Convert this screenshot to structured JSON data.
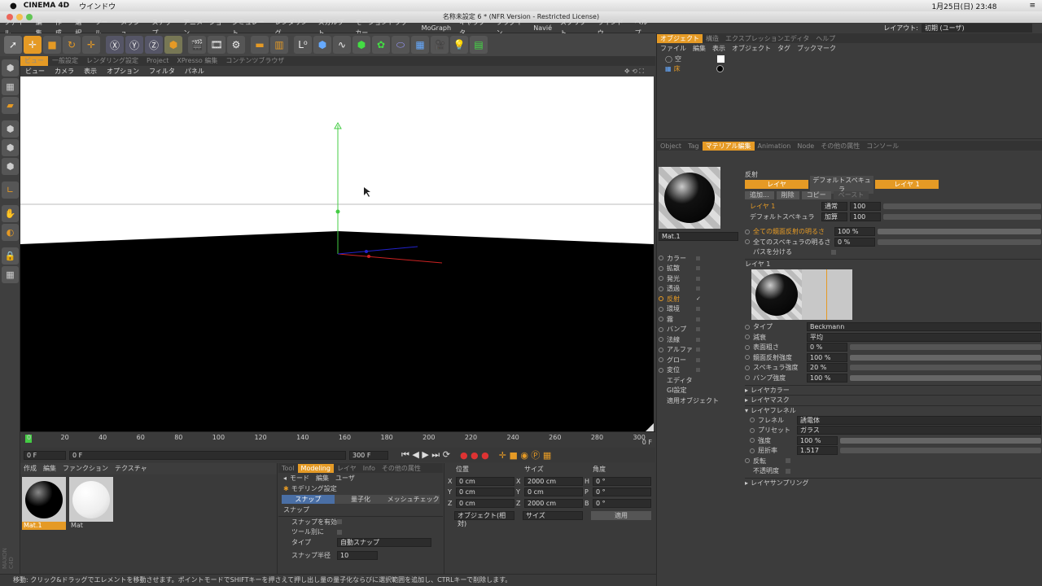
{
  "mac": {
    "app": "CINEMA 4D",
    "menu": "ウインドウ",
    "clock": "1月25日(日)  23:48"
  },
  "title": "名称未設定 6 * (NFR Version - Restricted License)",
  "menu": [
    "ファイル",
    "編集",
    "作成",
    "選択",
    "ツール",
    "メッシュ",
    "スナップ",
    "アニメーション",
    "シミュレート",
    "レンダリング",
    "スカルプト",
    "モーショントラッカー",
    "MoGraph",
    "キャラクタ",
    "プラグイン",
    "Navié",
    "スクリプト",
    "ウインドウ",
    "ヘルプ"
  ],
  "layout": {
    "label": "レイアウト:",
    "value": "初期 (ユーザ)"
  },
  "view_tabs": [
    "ビュー",
    "一般設定",
    "レンダリング設定",
    "Project",
    "XPresso 編集",
    "コンテンツブラウザ"
  ],
  "view_menu": [
    "ビュー",
    "カメラ",
    "表示",
    "オプション",
    "フィルタ",
    "パネル"
  ],
  "timeline": {
    "ticks": [
      "0",
      "20",
      "40",
      "60",
      "80",
      "100",
      "120",
      "140",
      "160",
      "180",
      "200",
      "220",
      "240",
      "260",
      "280",
      "300"
    ],
    "end_label": "0 F"
  },
  "range": {
    "start": "0 F",
    "min": "0 F",
    "max": "300 F",
    "end": "300 F"
  },
  "mat_menu": [
    "作成",
    "編集",
    "ファンクション",
    "テクスチャ"
  ],
  "materials": [
    {
      "name": "Mat.1",
      "color": "#000"
    },
    {
      "name": "Mat",
      "color": "#fff"
    }
  ],
  "attr_tabs": [
    "Tool",
    "Modeling",
    "レイヤ",
    "Info",
    "その他の属性"
  ],
  "attr_menu": [
    "モード",
    "編集",
    "ユーザ"
  ],
  "attr": {
    "title": "モデリング設定",
    "subtabs": [
      "スナップ",
      "量子化",
      "メッシュチェック"
    ],
    "section": "スナップ",
    "rows": [
      "スナップを有効",
      "ツール別に",
      "タイプ",
      "スナップ半径"
    ],
    "type_value": "自動スナップ",
    "radius": "10"
  },
  "coords": {
    "headers": [
      "位置",
      "サイズ",
      "角度"
    ],
    "rows": [
      [
        "X",
        "0 cm",
        "X",
        "2000 cm",
        "H",
        "0 °"
      ],
      [
        "Y",
        "0 cm",
        "Y",
        "0 cm",
        "P",
        "0 °"
      ],
      [
        "Z",
        "0 cm",
        "Z",
        "2000 cm",
        "B",
        "0 °"
      ]
    ],
    "mode1": "オブジェクト(相対)",
    "mode2": "サイズ",
    "apply": "適用"
  },
  "status": "移動: クリック&ドラッグでエレメントを移動させます。ポイントモードでSHIFTキーを押さえて押し出し量の量子化ならびに選択範囲を追加し、CTRLキーで削除します。",
  "obj_tabs": [
    "オブジェクト",
    "構造",
    "エクスプレッションエディタ",
    "ヘルプ"
  ],
  "obj_menu": [
    "ファイル",
    "編集",
    "表示",
    "オブジェクト",
    "タグ",
    "ブックマーク"
  ],
  "objects": [
    "空",
    "床"
  ],
  "mat_tabs": [
    "Object",
    "Tag",
    "マテリアル編集",
    "Animation",
    "Node",
    "その他の属性",
    "コンソール"
  ],
  "mat_name": "Mat.1",
  "channels": [
    "カラー",
    "拡散",
    "発光",
    "透過",
    "反射",
    "環境",
    "霧",
    "バンプ",
    "法線",
    "アルファ",
    "グロー",
    "変位",
    "エディタ",
    "GI設定",
    "適用オブジェクト"
  ],
  "refl": {
    "title": "反射",
    "layer_tabs": [
      "レイヤ",
      "デフォルトスペキュラ",
      "レイヤ 1"
    ],
    "buttons": [
      "追加...",
      "削除",
      "コピー",
      "ペースト"
    ],
    "layers": [
      {
        "name": "レイヤ 1",
        "mode": "通常",
        "val": "100"
      },
      {
        "name": "デフォルトスペキュラ",
        "mode": "加算",
        "val": "100"
      }
    ],
    "global": [
      [
        "全ての鏡面反射の明るさ",
        "100 %"
      ],
      [
        "全てのスペキュラの明るさ",
        "0 %"
      ]
    ],
    "sep_pass": "パスを分ける",
    "layer1": "レイヤ 1",
    "props": [
      [
        "タイプ",
        "Beckmann"
      ],
      [
        "減衰",
        "平均"
      ],
      [
        "表面粗さ",
        "0 %"
      ],
      [
        "鏡面反射強度",
        "100 %"
      ],
      [
        "スペキュラ強度",
        "20 %"
      ],
      [
        "バンプ強度",
        "100 %"
      ]
    ],
    "groups": [
      "レイヤカラー",
      "レイヤマスク",
      "レイヤフレネル"
    ],
    "fresnel": [
      [
        "フレネル",
        "誘電体"
      ],
      [
        "プリセット",
        "ガラス"
      ],
      [
        "強度",
        "100 %"
      ],
      [
        "屈折率",
        "1.517"
      ]
    ],
    "extra": [
      "反転",
      "不透明度"
    ],
    "last": "レイヤサンプリング"
  },
  "colors": {
    "accent": "#e59a25",
    "bg": "#3a3a3a"
  }
}
